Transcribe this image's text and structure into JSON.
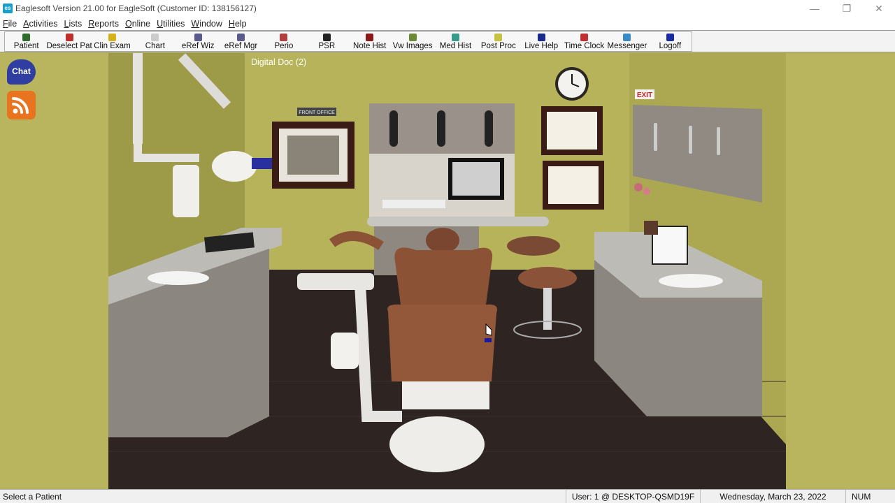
{
  "window": {
    "title": "Eaglesoft Version 21.00 for EagleSoft (Customer ID: 138156127)",
    "app_icon": "es",
    "controls": {
      "minimize": "—",
      "restore": "❐",
      "close": "✕"
    }
  },
  "menu": [
    {
      "acc": "F",
      "rest": "ile"
    },
    {
      "acc": "A",
      "rest": "ctivities"
    },
    {
      "acc": "L",
      "rest": "ists"
    },
    {
      "acc": "R",
      "rest": "eports"
    },
    {
      "acc": "O",
      "rest": "nline"
    },
    {
      "acc": "U",
      "rest": "tilities"
    },
    {
      "acc": "W",
      "rest": "indow"
    },
    {
      "acc": "H",
      "rest": "elp"
    }
  ],
  "toolbar": [
    {
      "label": "Patient",
      "icon": "patient-icon",
      "color": "#2f6b2f"
    },
    {
      "label": "Deselect Pat",
      "icon": "deselect-icon",
      "color": "#c0302a"
    },
    {
      "label": "Clin Exam",
      "icon": "clin-exam-icon",
      "color": "#d4b21c"
    },
    {
      "label": "Chart",
      "icon": "chart-icon",
      "color": "#cccccc"
    },
    {
      "label": "eRef Wiz",
      "icon": "eref-wiz-icon",
      "color": "#5a5a8a"
    },
    {
      "label": "eRef Mgr",
      "icon": "eref-mgr-icon",
      "color": "#5a5a8a"
    },
    {
      "label": "Perio",
      "icon": "perio-icon",
      "color": "#b04040"
    },
    {
      "label": "PSR",
      "icon": "psr-icon",
      "color": "#222222"
    },
    {
      "label": "Note Hist",
      "icon": "note-hist-icon",
      "color": "#8a1a1a"
    },
    {
      "label": "Vw Images",
      "icon": "vw-images-icon",
      "color": "#6a8a3a"
    },
    {
      "label": "Med Hist",
      "icon": "med-hist-icon",
      "color": "#3a9a8a"
    },
    {
      "label": "Post Proc",
      "icon": "post-proc-icon",
      "color": "#c8c040"
    },
    {
      "label": "Live Help",
      "icon": "live-help-icon",
      "color": "#1a2a8a"
    },
    {
      "label": "Time Clock",
      "icon": "time-clock-icon",
      "color": "#c03030"
    },
    {
      "label": "Messenger",
      "icon": "messenger-icon",
      "color": "#3a8ac8"
    },
    {
      "label": "Logoff",
      "icon": "logoff-icon",
      "color": "#1a2aa0"
    }
  ],
  "sidebar": {
    "chat_label": "Chat"
  },
  "scene": {
    "doc_title": "Digital Doc (2)",
    "sign_front_office": "FRONT OFFICE",
    "sign_exit": "EXIT"
  },
  "status": {
    "message": "Select a Patient",
    "user": "User: 1 @ DESKTOP-QSMD19F",
    "date": "Wednesday, March 23, 2022",
    "num": "NUM"
  },
  "colors": {
    "wall": "#b8b35c",
    "floor": "#2e2522",
    "accent_chat": "#2f3ea0",
    "accent_rss": "#e8741f"
  }
}
